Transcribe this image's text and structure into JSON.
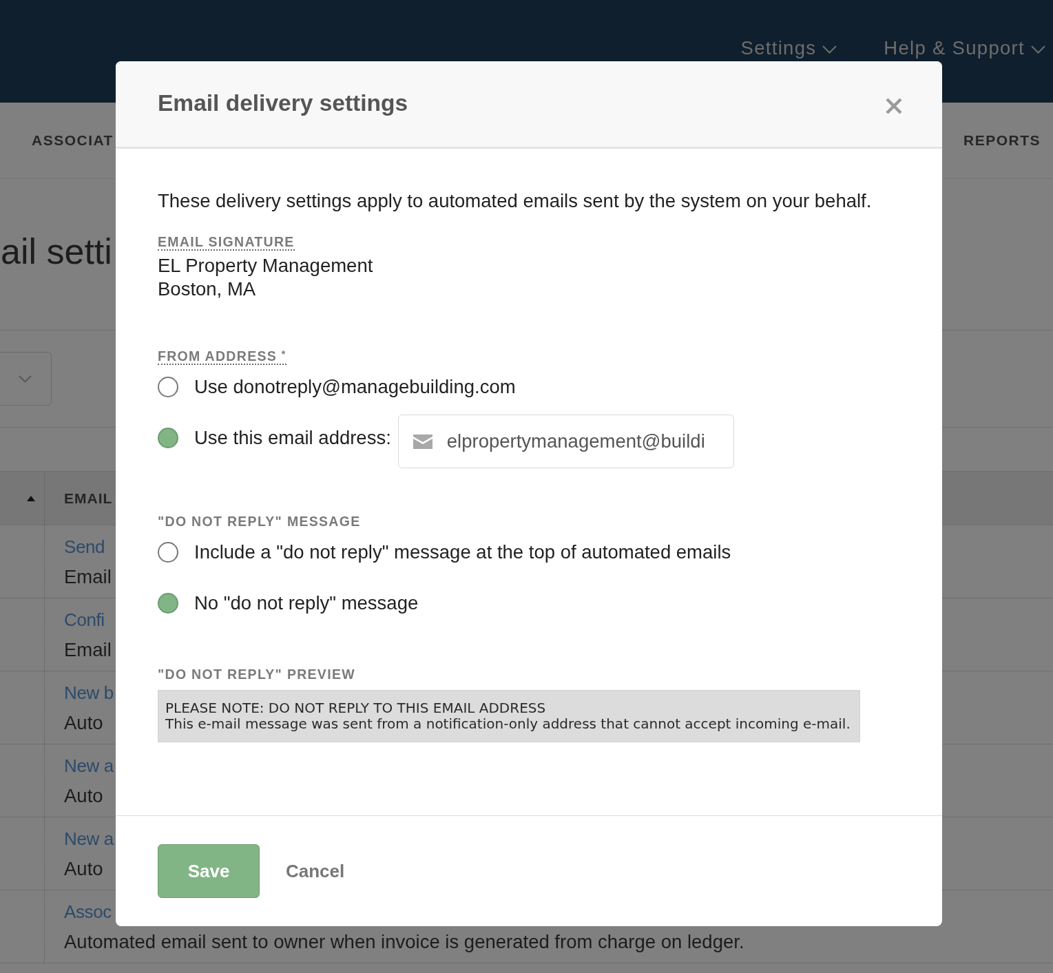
{
  "top_nav": {
    "items": [
      {
        "label": "Settings"
      },
      {
        "label": "Help & Support"
      }
    ]
  },
  "sub_nav": {
    "items": [
      {
        "label": "ASSOCIAT"
      },
      {
        "label": "REPORTS"
      }
    ]
  },
  "page": {
    "title": "ail setti"
  },
  "table": {
    "columns": [
      {
        "sorted": true,
        "descending": false
      },
      {
        "label": "EMAIL"
      }
    ],
    "rows": [
      {
        "title": "Send",
        "description": "Email"
      },
      {
        "title": "Confi",
        "description": "Email"
      },
      {
        "title": "New b",
        "description": "Auto"
      },
      {
        "title": "New a",
        "description": "Auto"
      },
      {
        "title": "New a",
        "description": "Auto"
      },
      {
        "title": "Assoc",
        "description": "Automated email sent to owner when invoice is generated from charge on ledger."
      }
    ]
  },
  "dialog": {
    "title": "Email delivery settings",
    "intro": "These delivery settings apply to automated emails sent by the system on your behalf.",
    "signature": {
      "label": "EMAIL SIGNATURE",
      "tooltip": true,
      "lines": [
        "EL Property Management",
        "Boston, MA"
      ]
    },
    "from_address": {
      "label": "FROM ADDRESS $^{*}$",
      "tooltip": true,
      "options": [
        {
          "label": "Use donotreply@managebuilding.com",
          "selected": false
        },
        {
          "label": "Use this email address:",
          "selected": true,
          "field": {
            "value": "elpropertymanagement@buildi"
          }
        }
      ]
    },
    "do_not_reply": {
      "label": "\"DO NOT REPLY\" MESSAGE",
      "tooltip": false,
      "options": [
        {
          "label": "Include a \"do not reply\" message at the top of automated emails",
          "selected": false
        },
        {
          "label": "No \"do not reply\" message",
          "selected": true
        }
      ]
    },
    "preview": {
      "label": "\"DO NOT REPLY\" PREVIEW",
      "tooltip": false,
      "heading": "PLEASE NOTE: DO NOT REPLY TO THIS EMAIL ADDRESS",
      "text": "This e-mail message was sent from a notification-only address that cannot accept incoming e-mail."
    },
    "buttons": [
      {
        "label": "Save",
        "kind": "primary"
      },
      {
        "label": "Cancel",
        "kind": "link"
      }
    ]
  }
}
